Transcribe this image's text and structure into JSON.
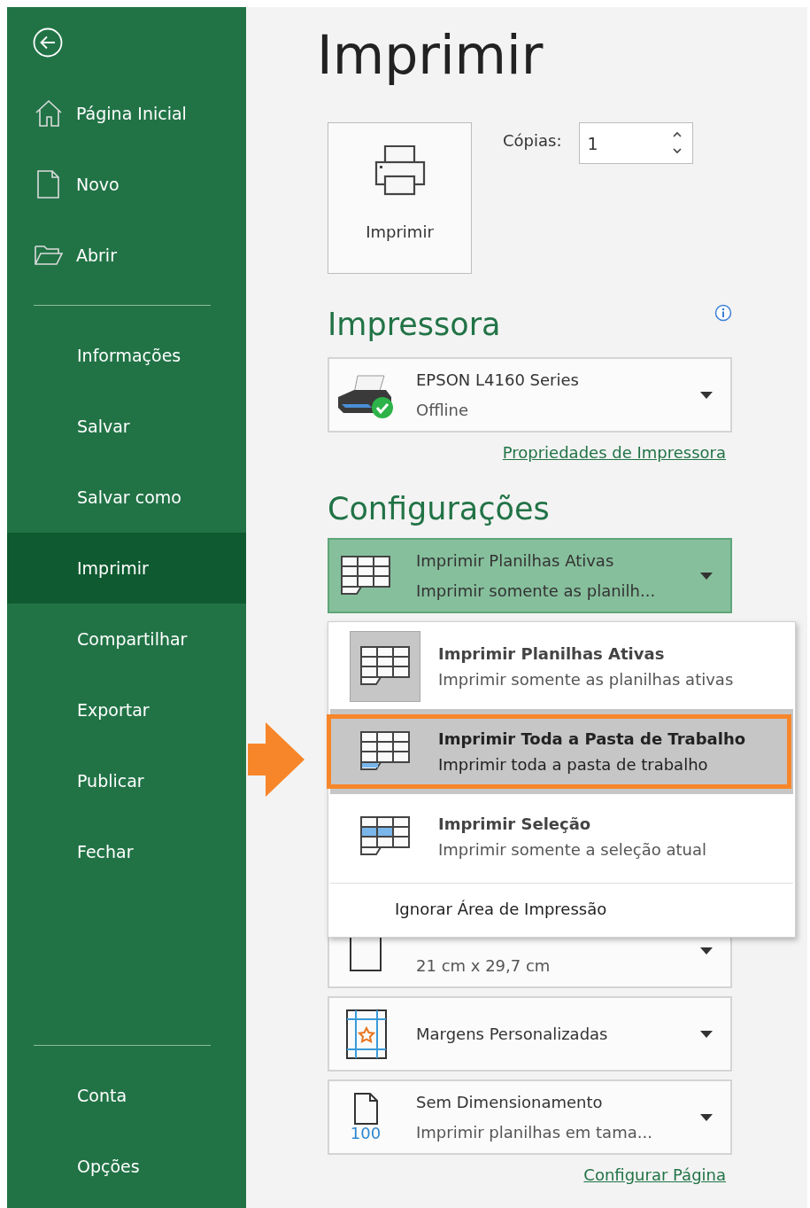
{
  "sidebar": {
    "top_items": [
      {
        "label": "Página Inicial",
        "kind": "home",
        "selected": false
      },
      {
        "label": "Novo",
        "kind": "document",
        "selected": false
      },
      {
        "label": "Abrir",
        "kind": "folder",
        "selected": false
      }
    ],
    "items": [
      {
        "label": "Informações",
        "selected": false
      },
      {
        "label": "Salvar",
        "selected": false
      },
      {
        "label": "Salvar como",
        "selected": false
      },
      {
        "label": "Imprimir",
        "selected": true
      },
      {
        "label": "Compartilhar",
        "selected": false
      },
      {
        "label": "Exportar",
        "selected": false
      },
      {
        "label": "Publicar",
        "selected": false
      },
      {
        "label": "Fechar",
        "selected": false
      }
    ],
    "footer_items": [
      {
        "label": "Conta",
        "selected": false
      },
      {
        "label": "Opções",
        "selected": false
      }
    ]
  },
  "title": "Imprimir",
  "print_button": {
    "label": "Imprimir"
  },
  "copies": {
    "label": "Cópias:",
    "value": "1"
  },
  "printer": {
    "heading": "Impressora",
    "name": "EPSON L4160 Series",
    "status": "Offline",
    "properties_link": "Propriedades de Impressora"
  },
  "settings": {
    "heading": "Configurações",
    "rows": [
      {
        "kind": "sheets",
        "title": "Imprimir Planilhas Ativas",
        "subtitle": "Imprimir somente as planilh...",
        "open": true
      },
      {
        "kind": "paper",
        "subtitle": "21 cm x 29,7 cm",
        "open": false
      },
      {
        "kind": "margins",
        "title": "Margens Personalizadas",
        "open": false
      },
      {
        "kind": "scaling",
        "icon_text": "100",
        "title": "Sem Dimensionamento",
        "subtitle": "Imprimir planilhas em tama...",
        "open": false
      }
    ],
    "page_setup_link": "Configurar Página"
  },
  "menu": {
    "options": [
      {
        "kind": "sheets",
        "title": "Imprimir Planilhas Ativas",
        "description": "Imprimir somente as planilhas ativas",
        "selected": true,
        "hovered": false,
        "highlighted": false
      },
      {
        "kind": "workbook",
        "title": "Imprimir Toda a Pasta de Trabalho",
        "description": "Imprimir toda a pasta de trabalho",
        "selected": false,
        "hovered": true,
        "highlighted": true
      },
      {
        "kind": "selection",
        "title": "Imprimir Seleção",
        "description": "Imprimir somente a seleção atual",
        "selected": false,
        "hovered": false,
        "highlighted": false
      }
    ],
    "footer_item": "Ignorar Área de Impressão"
  }
}
